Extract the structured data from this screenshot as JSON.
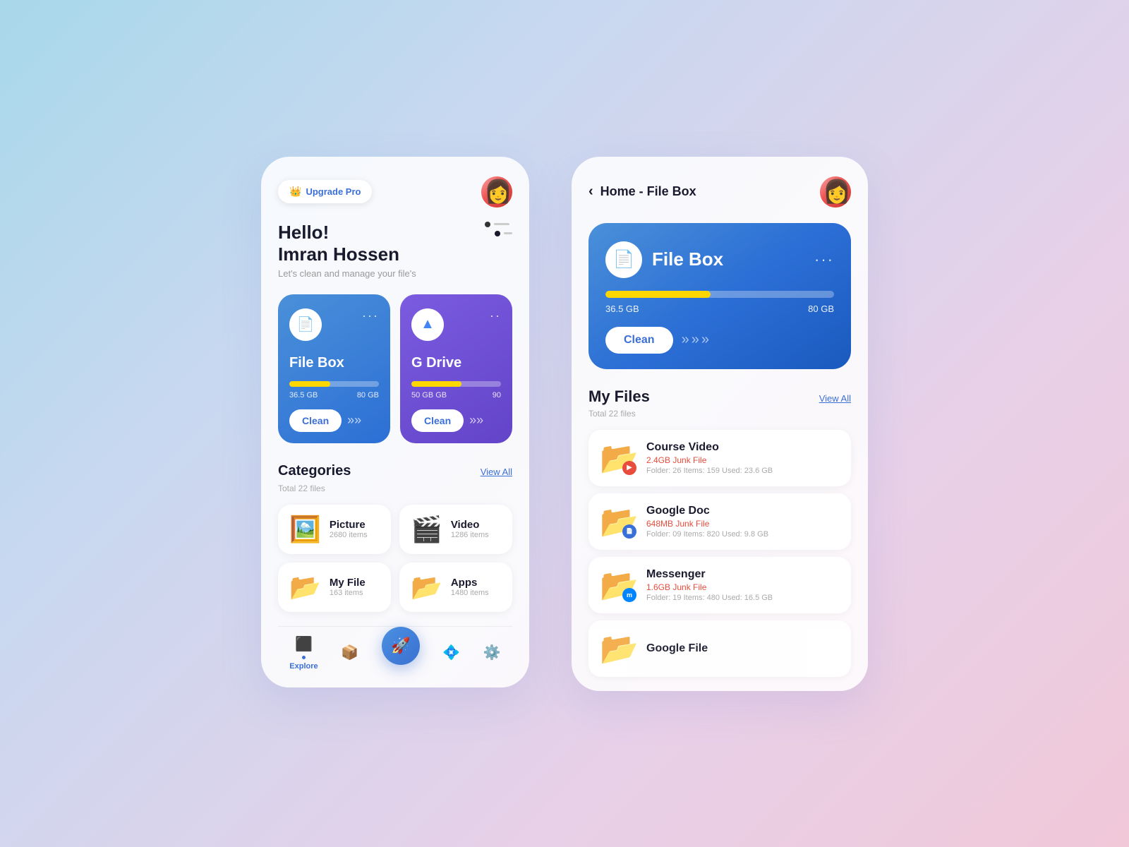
{
  "background": "#c8d8f0",
  "screen1": {
    "upgrade_btn": "Upgrade Pro",
    "greeting": {
      "hello": "Hello!",
      "name": "Imran Hossen",
      "subtitle": "Let's clean and manage your file's"
    },
    "cards": [
      {
        "id": "filebox",
        "title": "File Box",
        "icon": "📄",
        "used": "36.5 GB",
        "total": "80 GB",
        "fill_pct": 46,
        "clean_label": "Clean",
        "color": "blue"
      },
      {
        "id": "gdrive",
        "title": "G Drive",
        "icon": "△",
        "used": "50 GB GB",
        "total": "90",
        "fill_pct": 56,
        "clean_label": "Clean",
        "color": "purple"
      }
    ],
    "categories": {
      "title": "Categories",
      "subtitle": "Total 22 files",
      "view_all": "View All",
      "items": [
        {
          "name": "Picture",
          "items": "2680 items",
          "icon": "🖼️"
        },
        {
          "name": "Video",
          "items": "1286 items",
          "icon": "🎬"
        },
        {
          "name": "My File",
          "items": "163 items",
          "icon": "📁"
        },
        {
          "name": "Apps",
          "items": "1480 items",
          "icon": "📁"
        }
      ]
    },
    "nav": {
      "items": [
        {
          "label": "Explore",
          "icon": "⬛",
          "active": true
        },
        {
          "icon": "📦"
        },
        {
          "icon": "🚀",
          "fab": true
        },
        {
          "icon": "💠"
        },
        {
          "icon": "⚙️"
        }
      ]
    }
  },
  "screen2": {
    "back_label": "‹",
    "title": "Home - File Box",
    "filebox_card": {
      "icon": "📄",
      "title": "File Box",
      "used": "36.5 GB",
      "total": "80 GB",
      "fill_pct": 46,
      "clean_label": "Clean"
    },
    "my_files": {
      "title": "My Files",
      "subtitle": "Total 22 files",
      "view_all": "View All",
      "items": [
        {
          "name": "Course Video",
          "junk": "2.4GB Junk File",
          "meta": "Folder: 26 Items: 159 Used: 23.6 GB",
          "icon": "📁",
          "badge_icon": "▶",
          "badge_color": "red"
        },
        {
          "name": "Google Doc",
          "junk": "648MB Junk File",
          "meta": "Folder: 09  Items: 820  Used: 9.8 GB",
          "icon": "📁",
          "badge_icon": "📄",
          "badge_color": "blue"
        },
        {
          "name": "Messenger",
          "junk": "1.6GB Junk File",
          "meta": "Folder: 19  Items: 480  Used: 16.5 GB",
          "icon": "📁",
          "badge_icon": "m",
          "badge_color": "messenger"
        },
        {
          "name": "Google File",
          "junk": "",
          "meta": "",
          "icon": "📁",
          "badge_icon": "",
          "badge_color": ""
        }
      ]
    }
  }
}
